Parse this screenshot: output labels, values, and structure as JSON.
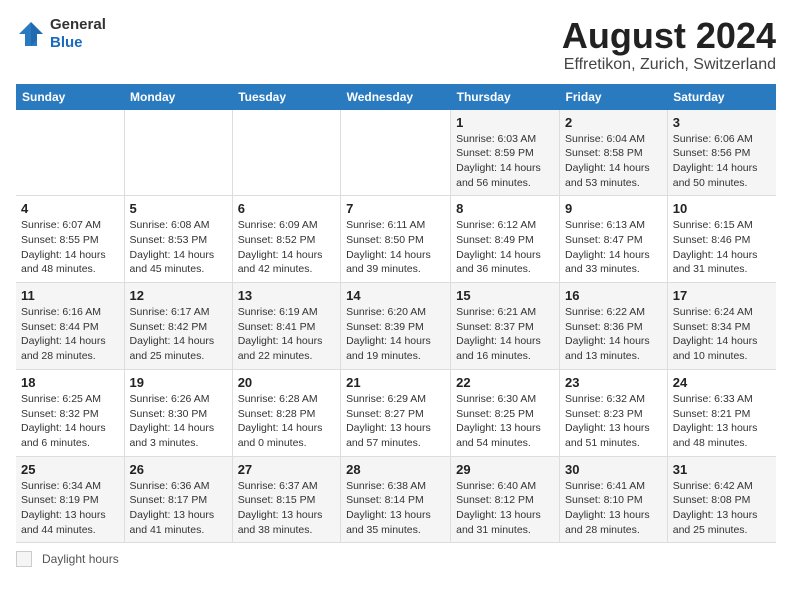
{
  "header": {
    "logo_line1": "General",
    "logo_line2": "Blue",
    "month_year": "August 2024",
    "location": "Effretikon, Zurich, Switzerland"
  },
  "weekdays": [
    "Sunday",
    "Monday",
    "Tuesday",
    "Wednesday",
    "Thursday",
    "Friday",
    "Saturday"
  ],
  "weeks": [
    [
      {
        "day": "",
        "info": ""
      },
      {
        "day": "",
        "info": ""
      },
      {
        "day": "",
        "info": ""
      },
      {
        "day": "",
        "info": ""
      },
      {
        "day": "1",
        "info": "Sunrise: 6:03 AM\nSunset: 8:59 PM\nDaylight: 14 hours and 56 minutes."
      },
      {
        "day": "2",
        "info": "Sunrise: 6:04 AM\nSunset: 8:58 PM\nDaylight: 14 hours and 53 minutes."
      },
      {
        "day": "3",
        "info": "Sunrise: 6:06 AM\nSunset: 8:56 PM\nDaylight: 14 hours and 50 minutes."
      }
    ],
    [
      {
        "day": "4",
        "info": "Sunrise: 6:07 AM\nSunset: 8:55 PM\nDaylight: 14 hours and 48 minutes."
      },
      {
        "day": "5",
        "info": "Sunrise: 6:08 AM\nSunset: 8:53 PM\nDaylight: 14 hours and 45 minutes."
      },
      {
        "day": "6",
        "info": "Sunrise: 6:09 AM\nSunset: 8:52 PM\nDaylight: 14 hours and 42 minutes."
      },
      {
        "day": "7",
        "info": "Sunrise: 6:11 AM\nSunset: 8:50 PM\nDaylight: 14 hours and 39 minutes."
      },
      {
        "day": "8",
        "info": "Sunrise: 6:12 AM\nSunset: 8:49 PM\nDaylight: 14 hours and 36 minutes."
      },
      {
        "day": "9",
        "info": "Sunrise: 6:13 AM\nSunset: 8:47 PM\nDaylight: 14 hours and 33 minutes."
      },
      {
        "day": "10",
        "info": "Sunrise: 6:15 AM\nSunset: 8:46 PM\nDaylight: 14 hours and 31 minutes."
      }
    ],
    [
      {
        "day": "11",
        "info": "Sunrise: 6:16 AM\nSunset: 8:44 PM\nDaylight: 14 hours and 28 minutes."
      },
      {
        "day": "12",
        "info": "Sunrise: 6:17 AM\nSunset: 8:42 PM\nDaylight: 14 hours and 25 minutes."
      },
      {
        "day": "13",
        "info": "Sunrise: 6:19 AM\nSunset: 8:41 PM\nDaylight: 14 hours and 22 minutes."
      },
      {
        "day": "14",
        "info": "Sunrise: 6:20 AM\nSunset: 8:39 PM\nDaylight: 14 hours and 19 minutes."
      },
      {
        "day": "15",
        "info": "Sunrise: 6:21 AM\nSunset: 8:37 PM\nDaylight: 14 hours and 16 minutes."
      },
      {
        "day": "16",
        "info": "Sunrise: 6:22 AM\nSunset: 8:36 PM\nDaylight: 14 hours and 13 minutes."
      },
      {
        "day": "17",
        "info": "Sunrise: 6:24 AM\nSunset: 8:34 PM\nDaylight: 14 hours and 10 minutes."
      }
    ],
    [
      {
        "day": "18",
        "info": "Sunrise: 6:25 AM\nSunset: 8:32 PM\nDaylight: 14 hours and 6 minutes."
      },
      {
        "day": "19",
        "info": "Sunrise: 6:26 AM\nSunset: 8:30 PM\nDaylight: 14 hours and 3 minutes."
      },
      {
        "day": "20",
        "info": "Sunrise: 6:28 AM\nSunset: 8:28 PM\nDaylight: 14 hours and 0 minutes."
      },
      {
        "day": "21",
        "info": "Sunrise: 6:29 AM\nSunset: 8:27 PM\nDaylight: 13 hours and 57 minutes."
      },
      {
        "day": "22",
        "info": "Sunrise: 6:30 AM\nSunset: 8:25 PM\nDaylight: 13 hours and 54 minutes."
      },
      {
        "day": "23",
        "info": "Sunrise: 6:32 AM\nSunset: 8:23 PM\nDaylight: 13 hours and 51 minutes."
      },
      {
        "day": "24",
        "info": "Sunrise: 6:33 AM\nSunset: 8:21 PM\nDaylight: 13 hours and 48 minutes."
      }
    ],
    [
      {
        "day": "25",
        "info": "Sunrise: 6:34 AM\nSunset: 8:19 PM\nDaylight: 13 hours and 44 minutes."
      },
      {
        "day": "26",
        "info": "Sunrise: 6:36 AM\nSunset: 8:17 PM\nDaylight: 13 hours and 41 minutes."
      },
      {
        "day": "27",
        "info": "Sunrise: 6:37 AM\nSunset: 8:15 PM\nDaylight: 13 hours and 38 minutes."
      },
      {
        "day": "28",
        "info": "Sunrise: 6:38 AM\nSunset: 8:14 PM\nDaylight: 13 hours and 35 minutes."
      },
      {
        "day": "29",
        "info": "Sunrise: 6:40 AM\nSunset: 8:12 PM\nDaylight: 13 hours and 31 minutes."
      },
      {
        "day": "30",
        "info": "Sunrise: 6:41 AM\nSunset: 8:10 PM\nDaylight: 13 hours and 28 minutes."
      },
      {
        "day": "31",
        "info": "Sunrise: 6:42 AM\nSunset: 8:08 PM\nDaylight: 13 hours and 25 minutes."
      }
    ]
  ],
  "footer": {
    "legend_label": "Daylight hours"
  }
}
